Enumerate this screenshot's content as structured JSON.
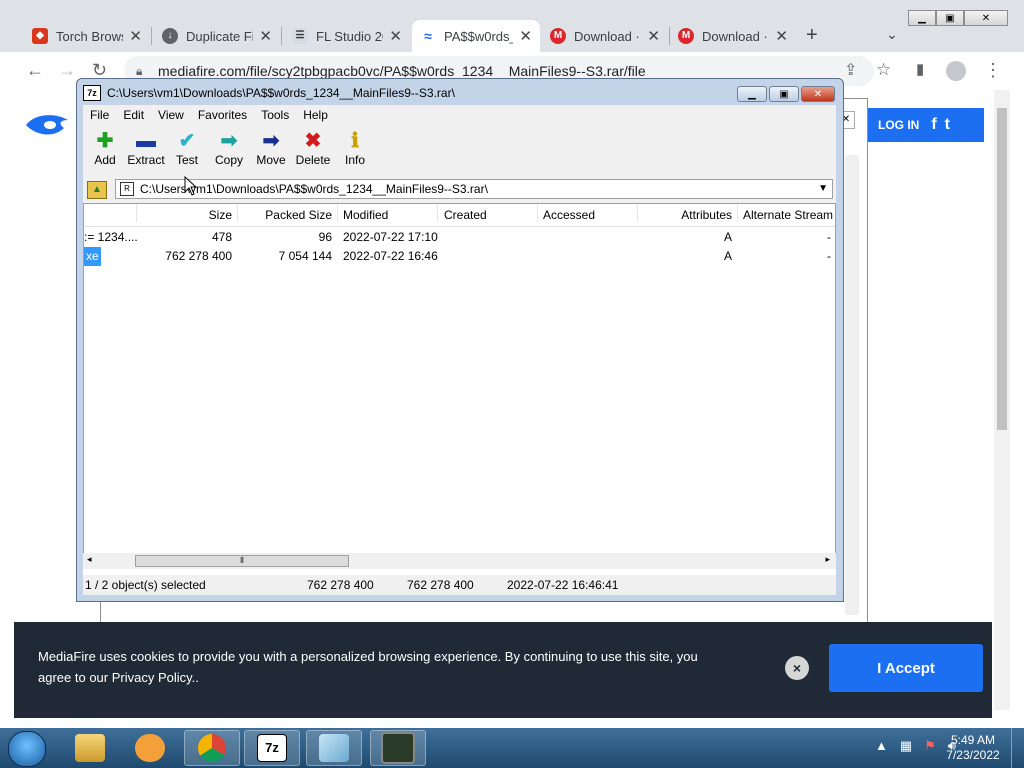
{
  "browser": {
    "tabs": [
      {
        "title": "Torch Browse",
        "favicon": "torch-icon",
        "color": "#d9381e"
      },
      {
        "title": "Duplicate Fi",
        "favicon": "globe-icon",
        "color": "#5f6368"
      },
      {
        "title": "FL Studio 20",
        "favicon": "fl-icon",
        "color": "#7e8a97"
      },
      {
        "title": "PA$$w0rds_",
        "favicon": "mediafire-icon",
        "color": "#1d6ff2"
      },
      {
        "title": "Download ·",
        "favicon": "mega-icon",
        "color": "#d9272e"
      },
      {
        "title": "Download ·",
        "favicon": "mega-icon",
        "color": "#d9272e"
      }
    ],
    "new_tab_symbol": "+",
    "url": "mediafire.com/file/scy2tpbgpacb0vc/PA$$w0rds_1234__MainFiles9--S3.rar/file"
  },
  "page": {
    "login_label": "LOG IN",
    "facebook_glyph": "f",
    "twitter_glyph": "t",
    "cookie_text": "MediaFire uses cookies to provide you with a personalized browsing experience. By continuing to use this site, you agree to our Privacy Policy..",
    "cookie_close_glyph": "×",
    "accept_label": "I Accept",
    "brand_color": "#1d6ff2"
  },
  "sevenzip": {
    "title": "C:\\Users\\vm1\\Downloads\\PA$$w0rds_1234__MainFiles9--S3.rar\\",
    "icon_label": "7z",
    "menu": [
      "File",
      "Edit",
      "View",
      "Favorites",
      "Tools",
      "Help"
    ],
    "tools": [
      {
        "label": "Add",
        "icon": "add-icon",
        "glyph": "✚",
        "color": "#1fa31f"
      },
      {
        "label": "Extract",
        "icon": "extract-icon",
        "glyph": "▬",
        "color": "#1b3aa8"
      },
      {
        "label": "Test",
        "icon": "test-icon",
        "glyph": "✔",
        "color": "#2bb3c9"
      },
      {
        "label": "Copy",
        "icon": "copy-icon",
        "glyph": "➡",
        "color": "#1aa39a"
      },
      {
        "label": "Move",
        "icon": "move-icon",
        "glyph": "➡",
        "color": "#1b2f8f"
      },
      {
        "label": "Delete",
        "icon": "delete-icon",
        "glyph": "✖",
        "color": "#d11b1b"
      },
      {
        "label": "Info",
        "icon": "info-icon",
        "glyph": "ℹ",
        "color": "#c8a000"
      }
    ],
    "address": "C:\\Users\\vm1\\Downloads\\PA$$w0rds_1234__MainFiles9--S3.rar\\",
    "columns": [
      "Size",
      "Packed Size",
      "Modified",
      "Created",
      "Accessed",
      "Attributes",
      "Alternate Stream"
    ],
    "rows": [
      {
        "name": ":= 1234....",
        "size": "478",
        "packed": "96",
        "modified": "2022-07-22 17:10",
        "created": "",
        "accessed": "",
        "attributes": "A",
        "alt": "-"
      },
      {
        "name": "xe",
        "size": "762 278 400",
        "packed": "7 054 144",
        "modified": "2022-07-22 16:46",
        "created": "",
        "accessed": "",
        "attributes": "A",
        "alt": "-"
      }
    ],
    "status": {
      "selected": "1 / 2 object(s) selected",
      "size": "762 278 400",
      "packed": "762 278 400",
      "date": "2022-07-22 16:46:41"
    }
  },
  "taskbar": {
    "time": "5:49 AM",
    "date": "7/23/2022",
    "sevenzip_label": "7z"
  }
}
